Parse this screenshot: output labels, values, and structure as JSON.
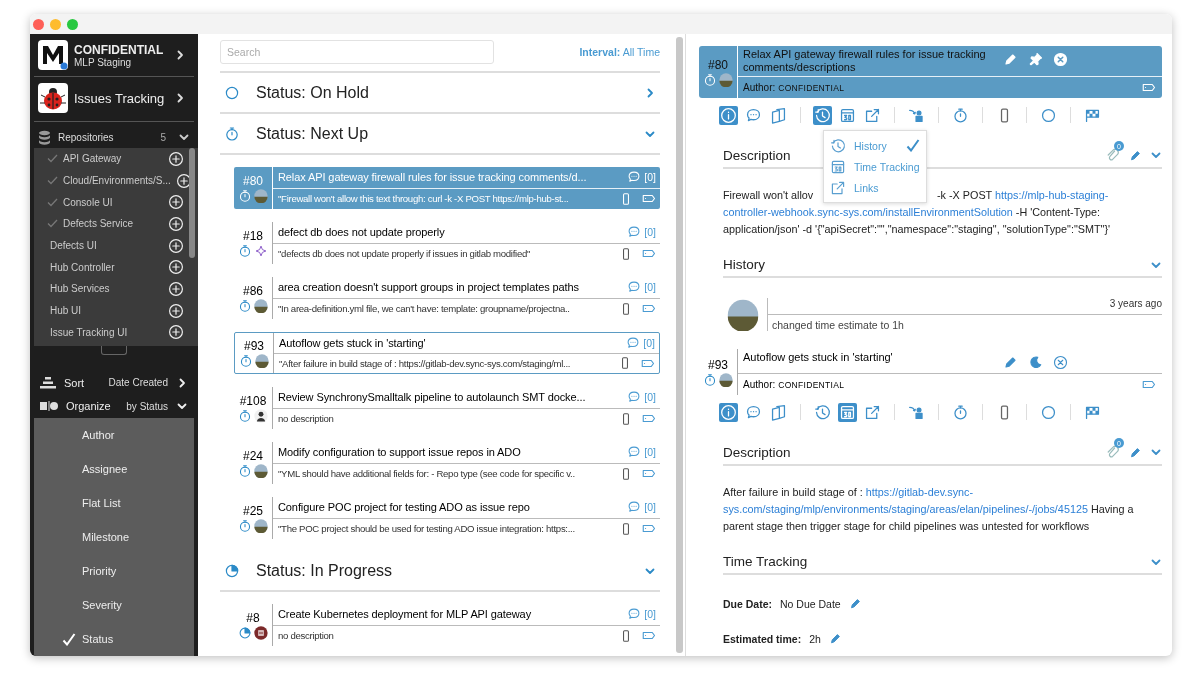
{
  "sidebar": {
    "workspace": {
      "name": "CONFIDENTIAL",
      "subtitle": "MLP Staging"
    },
    "app": {
      "name": "Issues Tracking"
    },
    "repositories": {
      "label": "Repositories",
      "count": "5",
      "expanded": true,
      "items": [
        {
          "name": "API Gateway",
          "checked": true
        },
        {
          "name": "Cloud/Environments/S...",
          "checked": true
        },
        {
          "name": "Console UI",
          "checked": true
        },
        {
          "name": "Defects Service",
          "checked": true
        },
        {
          "name": "Defects UI",
          "checked": false
        },
        {
          "name": "Hub Controller",
          "checked": false
        },
        {
          "name": "Hub Services",
          "checked": false
        },
        {
          "name": "Hub UI",
          "checked": false
        },
        {
          "name": "Issue Tracking UI",
          "checked": false
        }
      ]
    },
    "sort": {
      "label": "Sort",
      "value": "Date Created"
    },
    "organize": {
      "label": "Organize",
      "value": "by Status",
      "expanded": true,
      "options": [
        {
          "label": "Author",
          "selected": false
        },
        {
          "label": "Assignee",
          "selected": false
        },
        {
          "label": "Flat List",
          "selected": false
        },
        {
          "label": "Milestone",
          "selected": false
        },
        {
          "label": "Priority",
          "selected": false
        },
        {
          "label": "Severity",
          "selected": false
        },
        {
          "label": "Status",
          "selected": true
        }
      ]
    }
  },
  "issue_list": {
    "search": {
      "placeholder": "Search"
    },
    "interval": {
      "label": "Interval:",
      "value": "All Time"
    },
    "groups": [
      {
        "title": "Status: On Hold",
        "kind": "on_hold",
        "expanded": false
      },
      {
        "title": "Status: Next Up",
        "kind": "next_up",
        "expanded": true,
        "issues": [
          {
            "number": "#80",
            "title": "Relax API gateway firewall rules for issue tracking comments/d...",
            "description": "\"Firewall won't allow this text through: curl -k -X POST https://mlp-hub-st...",
            "comments": "[0]",
            "avatar": {
              "kind": "landscape"
            },
            "selected": true,
            "focused": false
          },
          {
            "number": "#18",
            "title": "defect db does not update properly",
            "description": "\"defects db does not update properly if issues in gitlab modified\"",
            "comments": "[0]",
            "avatar": {
              "kind": "pattern"
            },
            "selected": false,
            "focused": false
          },
          {
            "number": "#86",
            "title": "area creation doesn't support groups in project templates paths",
            "description": "\"In area-definition.yml file, we can't have: template: groupname/projectna..",
            "comments": "[0]",
            "avatar": {
              "kind": "landscape"
            },
            "selected": false,
            "focused": false
          },
          {
            "number": "#93",
            "title": "Autoflow gets stuck in 'starting'",
            "description": "\"After failure in build stage of : https://gitlab-dev.sync-sys.com/staging/ml...",
            "comments": "[0]",
            "avatar": {
              "kind": "landscape"
            },
            "selected": false,
            "focused": true
          },
          {
            "number": "#108",
            "title": "Review SynchronySmalltalk pipeline to autolaunch SMT docke...",
            "description": "no description",
            "comments": "[0]",
            "avatar": {
              "kind": "person"
            },
            "selected": false,
            "focused": false
          },
          {
            "number": "#24",
            "title": "Modify configuration to support issue repos in ADO",
            "description": "\"YML should have additional fields for: - Repo type (see code for specific v..",
            "comments": "[0]",
            "avatar": {
              "kind": "landscape"
            },
            "selected": false,
            "focused": false
          },
          {
            "number": "#25",
            "title": "Configure POC project for testing ADO as issue repo",
            "description": "\"The POC project should be used for testing ADO issue integration: https:...",
            "comments": "[0]",
            "avatar": {
              "kind": "landscape"
            },
            "selected": false,
            "focused": false
          }
        ]
      },
      {
        "title": "Status: In Progress",
        "kind": "in_progress",
        "expanded": true,
        "issues": [
          {
            "number": "#8",
            "title": "Create Kubernetes deployment for MLP API gateway",
            "description": "no description",
            "comments": "[0]",
            "avatar": {
              "kind": "emblem"
            },
            "selected": false,
            "focused": false
          }
        ]
      }
    ]
  },
  "detail": {
    "cards": [
      {
        "number": "#80",
        "status": {
          "kind": "next_up"
        },
        "avatar": {
          "kind": "landscape"
        },
        "title": "Relax API gateway firewall rules for issue tracking comments/descriptions",
        "author_label": "Author:",
        "author": "CONFIDENTIAL",
        "selected": true,
        "actions": [
          {
            "kind": "edit"
          },
          {
            "kind": "pin"
          },
          {
            "kind": "close"
          }
        ],
        "toolbar": [
          {
            "kind": "info",
            "selected": true
          },
          {
            "kind": "comments",
            "selected": false
          },
          {
            "kind": "checklist",
            "selected": false
          },
          {
            "kind": "history",
            "selected": true
          },
          {
            "kind": "calendar",
            "selected": false
          },
          {
            "kind": "links",
            "selected": false
          },
          {
            "kind": "assign",
            "selected": false
          },
          {
            "kind": "stopwatch",
            "selected": false
          },
          {
            "kind": "device",
            "selected": false
          },
          {
            "kind": "status",
            "selected": false
          },
          {
            "kind": "milestone",
            "selected": false
          }
        ],
        "menu": [
          {
            "kind": "history",
            "label": "History",
            "selected": true
          },
          {
            "kind": "calendar",
            "label": "Time Tracking",
            "selected": false
          },
          {
            "kind": "links",
            "label": "Links",
            "selected": false
          }
        ],
        "sections": [
          {
            "kind": "description",
            "title": "Description",
            "attachments": "0",
            "lines": [
              [
                {
                  "kind": "text",
                  "text": "Firewall won't allov"
                },
                {
                  "kind": "gap"
                },
                {
                  "kind": "text",
                  "text": "-k -X POST "
                },
                {
                  "kind": "link",
                  "text": "https://mlp-hub-staging-"
                }
              ],
              [
                {
                  "kind": "link",
                  "text": "controller-webhook.sync-sys.com/installEnvironmentSolution"
                },
                {
                  "kind": "text",
                  "text": " -H 'Content-Type:"
                }
              ],
              [
                {
                  "kind": "text",
                  "text": "application/json' -d '{\"apiSecret\":\"\",\"namespace\":\"staging\", \"solutionType\":\"SMT\"}'"
                }
              ]
            ]
          },
          {
            "kind": "history",
            "title": "History",
            "entries": [
              {
                "avatar": {
                  "kind": "landscape"
                },
                "time": "3 years ago",
                "text": "changed time estimate to 1h"
              }
            ]
          }
        ]
      },
      {
        "number": "#93",
        "status": {
          "kind": "next_up"
        },
        "avatar": {
          "kind": "landscape"
        },
        "title": "Autoflow gets stuck in 'starting'",
        "author_label": "Author:",
        "author": "CONFIDENTIAL",
        "selected": false,
        "actions": [
          {
            "kind": "edit"
          },
          {
            "kind": "watch"
          },
          {
            "kind": "close"
          }
        ],
        "toolbar": [
          {
            "kind": "info",
            "selected": true
          },
          {
            "kind": "comments",
            "selected": false
          },
          {
            "kind": "checklist",
            "selected": false
          },
          {
            "kind": "history",
            "selected": false
          },
          {
            "kind": "calendar",
            "selected": true
          },
          {
            "kind": "links",
            "selected": false
          },
          {
            "kind": "assign",
            "selected": false
          },
          {
            "kind": "stopwatch",
            "selected": false
          },
          {
            "kind": "device",
            "selected": false
          },
          {
            "kind": "status",
            "selected": false
          },
          {
            "kind": "milestone",
            "selected": false
          }
        ],
        "sections": [
          {
            "kind": "description",
            "title": "Description",
            "attachments": "0",
            "lines": [
              [
                {
                  "kind": "text",
                  "text": "After failure in build stage of : "
                },
                {
                  "kind": "link",
                  "text": "https://gitlab-dev.sync-"
                }
              ],
              [
                {
                  "kind": "link",
                  "text": "sys.com/staging/mlp/environments/staging/areas/elan/pipelines/-/jobs/45125"
                },
                {
                  "kind": "text",
                  "text": " Having a"
                }
              ],
              [
                {
                  "kind": "text",
                  "text": "parent stage then trigger stage for child pipelines was untested for workflows"
                }
              ]
            ]
          },
          {
            "kind": "time_tracking",
            "title": "Time Tracking",
            "fields": [
              {
                "label": "Due Date:",
                "value": "No Due Date"
              },
              {
                "label": "Estimated time:",
                "value": "2h"
              }
            ]
          }
        ]
      }
    ]
  }
}
